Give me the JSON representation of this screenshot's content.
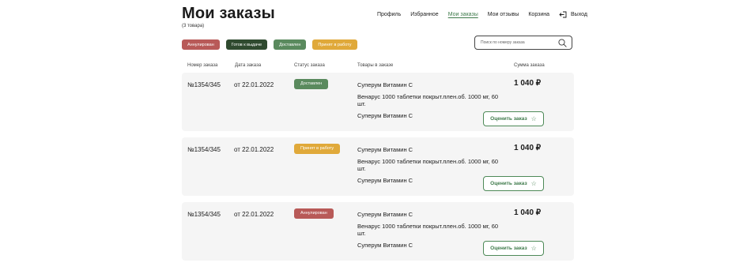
{
  "header": {
    "title": "Мои заказы",
    "count": "(3 товара)"
  },
  "nav": {
    "profile": "Профиль",
    "favorites": "Избранное",
    "orders": "Мои заказы",
    "reviews": "Мои отзывы",
    "cart": "Корзина",
    "exit": "Выход"
  },
  "filters": [
    {
      "label": "Аннулирован",
      "color": "#b85a58"
    },
    {
      "label": "Готов к выдаче",
      "color": "#2f4a2f"
    },
    {
      "label": "Доставлен",
      "color": "#5a8a5e"
    },
    {
      "label": "Принят в работу",
      "color": "#e0a93a"
    }
  ],
  "search": {
    "placeholder": "Поиск по номеру заказа"
  },
  "table_headers": {
    "number": "Номер заказа",
    "date": "Дата заказа",
    "status": "Статус заказа",
    "items": "Товары в заказе",
    "sum": "Сумма заказа"
  },
  "orders": [
    {
      "number": "№1354/345",
      "date": "от 22.01.2022",
      "status": "Доставлен",
      "status_color": "#5a8a5e",
      "items": [
        "Суперум Витамин С",
        "Венарус 1000 таблетки покрыт.плен.об. 1000 мг, 60 шт.",
        "Суперум Витамин С"
      ],
      "sum": "1 040 ₽",
      "rate_label": "Оценить заказ"
    },
    {
      "number": "№1354/345",
      "date": "от 22.01.2022",
      "status": "Принят в работу",
      "status_color": "#e0a93a",
      "items": [
        "Суперум Витамин С",
        "Венарус 1000 таблетки покрыт.плен.об. 1000 мг, 60 шт.",
        "Суперум Витамин С"
      ],
      "sum": "1 040 ₽",
      "rate_label": "Оценить заказ"
    },
    {
      "number": "№1354/345",
      "date": "от 22.01.2022",
      "status": "Аннулирован",
      "status_color": "#b85a58",
      "items": [
        "Суперум Витамин С",
        "Венарус 1000 таблетки покрыт.плен.об. 1000 мг, 60 шт.",
        "Суперум Витамин С"
      ],
      "sum": "1 040 ₽",
      "rate_label": "Оценить заказ"
    }
  ]
}
